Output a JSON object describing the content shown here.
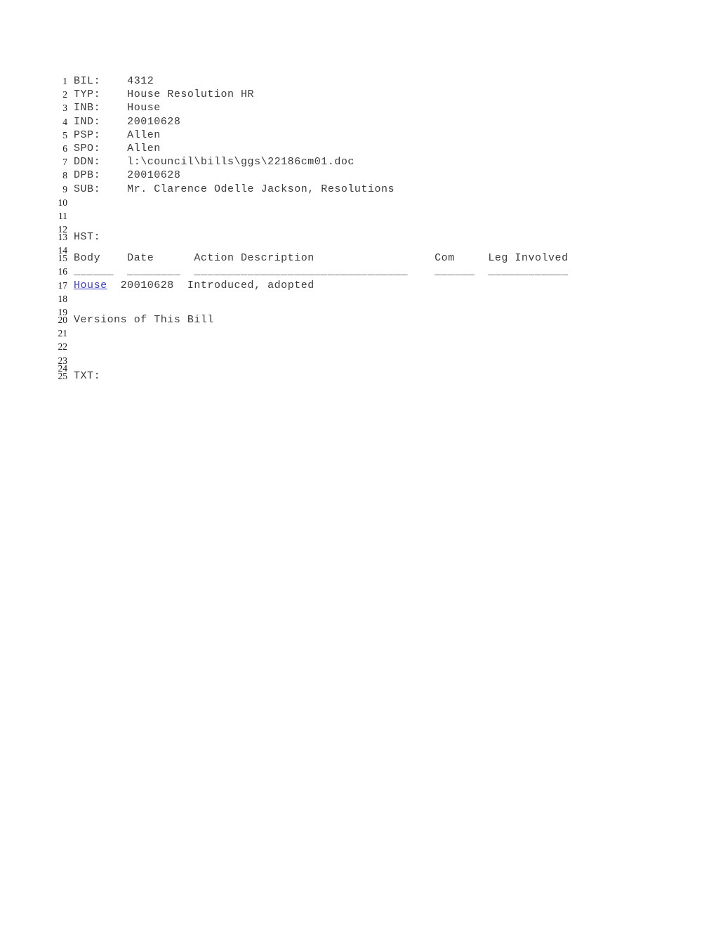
{
  "document": {
    "type": "legislative-bill-record",
    "background_color": "#ffffff",
    "text_color": "#3a3a3a",
    "link_color": "#3b3bd0",
    "rule_color": "#808080"
  },
  "fields": {
    "bil_label": "BIL:",
    "bil_value": "4312",
    "typ_label": "TYP:",
    "typ_value": "House Resolution HR",
    "inb_label": "INB:",
    "inb_value": "House",
    "ind_label": "IND:",
    "ind_value": "20010628",
    "psp_label": "PSP:",
    "psp_value": "Allen",
    "spo_label": "SPO:",
    "spo_value": "Allen",
    "ddn_label": "DDN:",
    "ddn_value": "l:\\council\\bills\\ggs\\22186cm01.doc",
    "dpb_label": "DPB:",
    "dpb_value": "20010628",
    "sub_label": "SUB:",
    "sub_value": "Mr. Clarence Odelle Jackson, Resolutions"
  },
  "history": {
    "section_label": "HST:",
    "columns": {
      "body": "Body",
      "date": "Date",
      "action": "Action Description",
      "com": "Com",
      "leg": "Leg Involved"
    },
    "rules": {
      "body": "______",
      "date": "________",
      "action": "________________________________",
      "com": "______",
      "leg": "____________"
    },
    "rows": [
      {
        "body": "House",
        "body_is_link": true,
        "date": "20010628",
        "action": "Introduced, adopted",
        "com": "",
        "leg": ""
      }
    ]
  },
  "versions": {
    "heading": "Versions of This Bill"
  },
  "text_section": {
    "label": "TXT:"
  },
  "line_numbers": {
    "n1": "1",
    "n2": "2",
    "n3": "3",
    "n4": "4",
    "n5": "5",
    "n6": "6",
    "n7": "7",
    "n8": "8",
    "n9": "9",
    "n10": "10",
    "n11": "11",
    "n12": "12",
    "n13": "13",
    "n14": "14",
    "n15": "15",
    "n16": "16",
    "n17": "17",
    "n18": "18",
    "n19": "19",
    "n20": "20",
    "n21": "21",
    "n22": "22",
    "n23": "23",
    "n24": "24",
    "n25": "25"
  },
  "composed": {
    "line1": "BIL:    4312",
    "line2": "TYP:    House Resolution HR",
    "line3": "INB:    House",
    "line4": "IND:    20010628",
    "line5": "PSP:    Allen",
    "line6": "SPO:    Allen",
    "line7": "DDN:    l:\\council\\bills\\ggs\\22186cm01.doc",
    "line8": "DPB:    20010628",
    "line9": "SUB:    Mr. Clarence Odelle Jackson, Resolutions",
    "line13": "HST:",
    "line15": "Body    Date      Action Description                  Com     Leg Involved",
    "line16": "______  ________  ________________________________    ______  ____________",
    "line17_date_action": "  20010628  Introduced, adopted",
    "line20": "Versions of This Bill",
    "line25": "TXT:"
  }
}
